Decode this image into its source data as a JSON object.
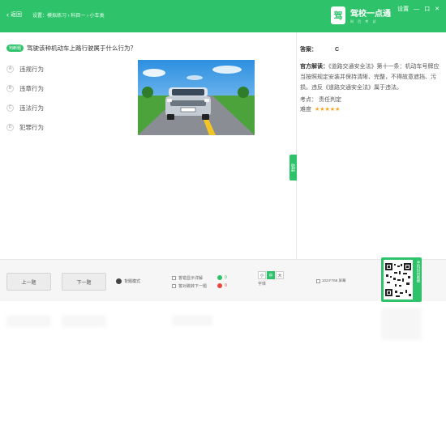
{
  "header": {
    "back_label": "返回",
    "breadcrumb": "设置：模拟练习 › 科目一 › 小车类",
    "brand_mark": "驾",
    "brand_name": "驾校一点通",
    "brand_sub": "科 目 考 试",
    "window_controls": [
      "设置",
      "—",
      "口",
      "✕"
    ]
  },
  "question": {
    "type_badge": "判断题",
    "text": "驾驶该种机动车上路行驶属于什么行为？",
    "options": [
      {
        "letter": "A",
        "label": "违规行为"
      },
      {
        "letter": "B",
        "label": "违章行为"
      },
      {
        "letter": "C",
        "label": "违法行为"
      },
      {
        "letter": "D",
        "label": "犯罪行为"
      }
    ]
  },
  "answer_panel": {
    "answer_label": "答案：",
    "answer_value": "C",
    "explain_label": "官方解读：",
    "explain_text": "《道路交通安全法》第十一条：机动车号牌应当按照规定安装并保持清晰、完整，不得故意遮挡、污损。违反《道路交通安全法》属于违法。",
    "point_label": "考点：",
    "point_value": "责任判定",
    "difficulty_label": "难度",
    "difficulty_stars": "★★★★★",
    "side_tab": "收起"
  },
  "toolbar": {
    "prev_label": "上一题",
    "next_label": "下一题",
    "mode_label": "背题模式",
    "check1": "答错显示详解",
    "check2": "答对跳转下一题",
    "correct_count": "0",
    "wrong_count": "0",
    "font_options": [
      "小",
      "中",
      "大"
    ],
    "font_label": "字体",
    "screen_label": "1024*768 屏幕"
  },
  "qr": {
    "caption": "手机扫码刷题"
  },
  "colors": {
    "accent": "#2ec36a",
    "error": "#e7473c",
    "star": "#f5a623"
  }
}
